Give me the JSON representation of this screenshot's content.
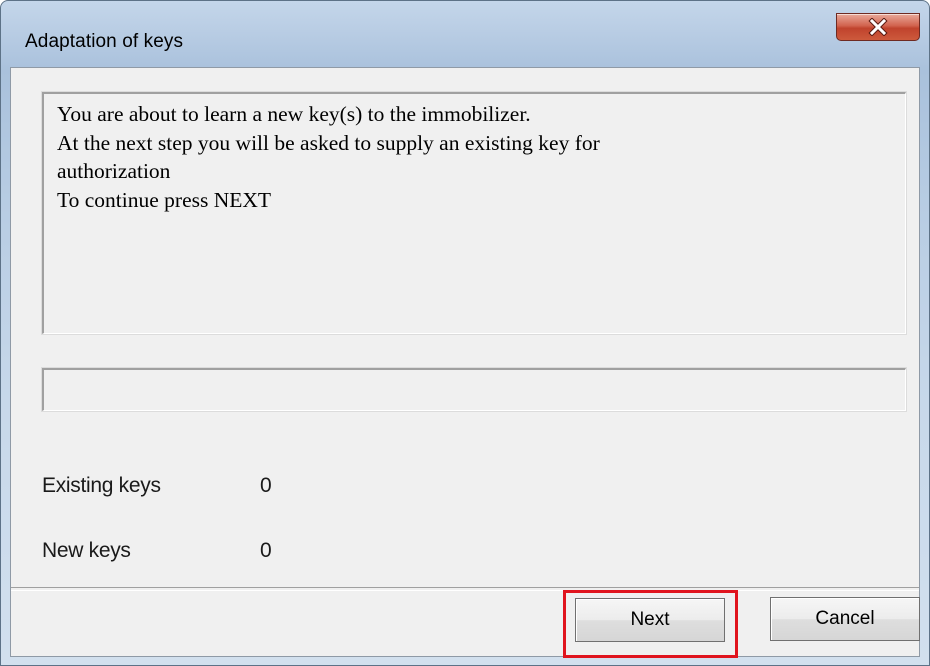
{
  "window": {
    "title": "Adaptation of keys",
    "close_icon": "close-x-icon"
  },
  "message": {
    "lines": [
      "You are about to learn a new key(s) to the immobilizer.",
      "At the next step you will be asked to supply an existing key for",
      "authorization",
      "To continue press NEXT"
    ]
  },
  "progress": {
    "value": 0
  },
  "keys": {
    "existing_label": "Existing keys",
    "existing_value": "0",
    "new_label": "New keys",
    "new_value": "0"
  },
  "buttons": {
    "next_label": "Next",
    "cancel_label": "Cancel"
  },
  "colors": {
    "highlight": "#e0141e",
    "close_button": "#c7432d",
    "dialog_bg": "#f0f0f0"
  }
}
